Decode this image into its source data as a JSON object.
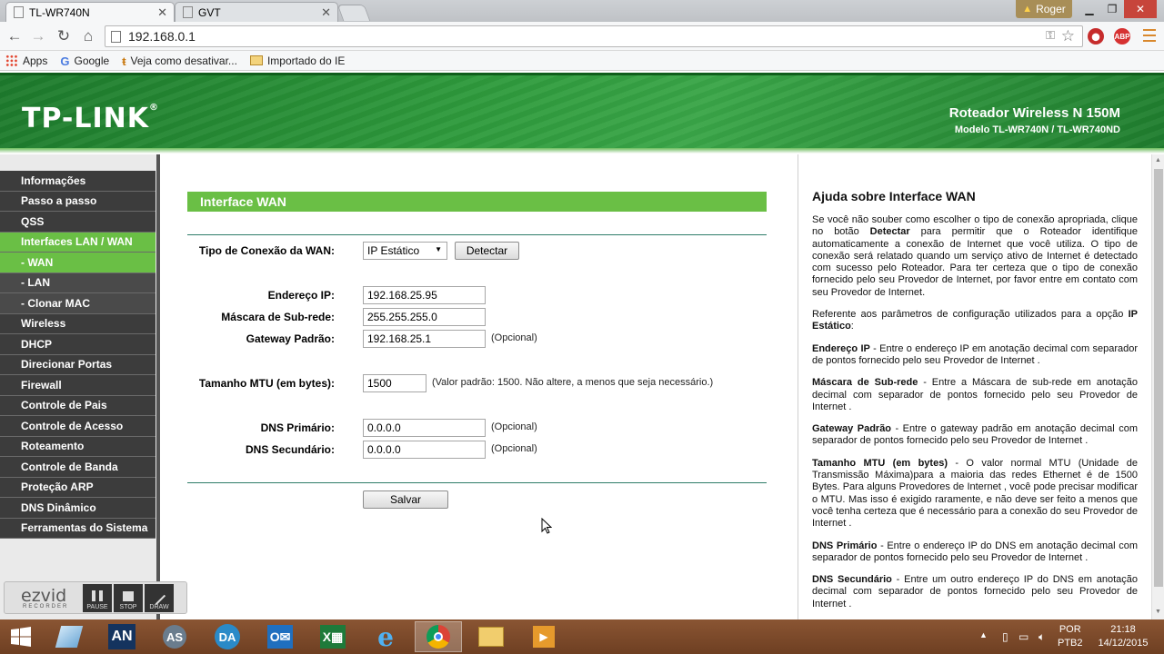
{
  "browser": {
    "tabs": [
      {
        "title": "TL-WR740N",
        "active": true
      },
      {
        "title": "GVT",
        "active": false
      }
    ],
    "user": "Roger",
    "url": "192.168.0.1",
    "bookmarks": [
      "Apps",
      "Google",
      "Veja como desativar...",
      "Importado do IE"
    ],
    "extensions": [
      "adblock-icon",
      "abp-icon"
    ]
  },
  "router": {
    "logo": "TP-LINK",
    "product_title": "Roteador Wireless N 150M",
    "product_model": "Modelo TL-WR740N / TL-WR740ND"
  },
  "menu": [
    {
      "label": "Informações",
      "active": false,
      "sub": false
    },
    {
      "label": "Passo a passo",
      "active": false,
      "sub": false
    },
    {
      "label": "QSS",
      "active": false,
      "sub": false
    },
    {
      "label": "Interfaces LAN / WAN",
      "active": true,
      "sub": false
    },
    {
      "label": "- WAN",
      "active": true,
      "sub": true
    },
    {
      "label": "- LAN",
      "active": false,
      "sub": true
    },
    {
      "label": "- Clonar MAC",
      "active": false,
      "sub": true
    },
    {
      "label": "Wireless",
      "active": false,
      "sub": false
    },
    {
      "label": "DHCP",
      "active": false,
      "sub": false
    },
    {
      "label": "Direcionar Portas",
      "active": false,
      "sub": false
    },
    {
      "label": "Firewall",
      "active": false,
      "sub": false
    },
    {
      "label": "Controle de Pais",
      "active": false,
      "sub": false
    },
    {
      "label": "Controle de Acesso",
      "active": false,
      "sub": false
    },
    {
      "label": "Roteamento",
      "active": false,
      "sub": false
    },
    {
      "label": "Controle de Banda",
      "active": false,
      "sub": false
    },
    {
      "label": "Proteção ARP",
      "active": false,
      "sub": false
    },
    {
      "label": "DNS Dinâmico",
      "active": false,
      "sub": false
    },
    {
      "label": "Ferramentas do Sistema",
      "active": false,
      "sub": false
    }
  ],
  "wan": {
    "section_title": "Interface WAN",
    "conn_type_label": "Tipo de Conexão da WAN:",
    "conn_type_value": "IP Estático",
    "detect_button": "Detectar",
    "ip_label": "Endereço IP:",
    "ip_value": "192.168.25.95",
    "mask_label": "Máscara de Sub-rede:",
    "mask_value": "255.255.255.0",
    "gateway_label": "Gateway Padrão:",
    "gateway_value": "192.168.25.1",
    "optional": "(Opcional)",
    "mtu_label": "Tamanho MTU (em bytes):",
    "mtu_value": "1500",
    "mtu_hint": "(Valor padrão: 1500. Não altere, a menos que seja necessário.)",
    "dns1_label": "DNS Primário:",
    "dns1_value": "0.0.0.0",
    "dns2_label": "DNS Secundário:",
    "dns2_value": "0.0.0.0",
    "save_button": "Salvar"
  },
  "help": {
    "title": "Ajuda sobre Interface WAN",
    "p1_a": "Se você não souber como escolher o tipo de conexão apropriada, clique no botão ",
    "p1_b": "Detectar",
    "p1_c": " para permitir que o Roteador identifique automaticamente a conexão de Internet que você utiliza. O tipo de conexão será relatado quando um serviço ativo de Internet é detectado com sucesso pelo Roteador. Para ter certeza que o tipo de conexão fornecido pelo seu Provedor de Internet, por favor entre em contato com seu Provedor de Internet.",
    "p2_a": "Referente aos parâmetros de configuração utilizados para a opção ",
    "p2_b": "IP Estático",
    "p2_c": ":",
    "ip_term": "Endereço IP",
    "ip_desc": " - Entre o endereço IP em anotação decimal com separador de pontos fornecido pelo seu Provedor de Internet .",
    "mask_term": "Máscara de Sub-rede",
    "mask_desc": " - Entre a Máscara de sub-rede em anotação decimal com separador de pontos fornecido pelo seu Provedor de Internet .",
    "gw_term": "Gateway Padrão",
    "gw_desc": " - Entre o gateway padrão em anotação decimal com separador de pontos fornecido pelo seu Provedor de Internet .",
    "mtu_term": "Tamanho MTU (em bytes)",
    "mtu_desc": " - O valor normal MTU (Unidade de Transmissão Máxima)para a maioria das redes Ethernet é de 1500 Bytes. Para alguns Provedores de Internet , você pode precisar modificar o MTU. Mas isso é exigido raramente, e não deve ser feito a menos que você tenha certeza que é necessário para a conexão do seu Provedor de Internet .",
    "dns1_term": "DNS Primário",
    "dns1_desc": " - Entre o endereço IP do DNS em anotação decimal com separador de pontos fornecido pelo seu Provedor de Internet .",
    "dns2_term": "DNS Secundário",
    "dns2_desc": " - Entre um outro endereço IP do DNS em anotação decimal com separador de pontos fornecido pelo seu Provedor de Internet ."
  },
  "ezvid": {
    "logo": "ezvid",
    "sub": "RECORDER",
    "buttons": [
      "PAUSE",
      "STOP",
      "DRAW"
    ]
  },
  "taskbar": {
    "apps": [
      "file-explorer-icon",
      "an-app-icon",
      "as-app-icon",
      "da-app-icon",
      "outlook-icon",
      "excel-icon",
      "ie-icon",
      "chrome-icon",
      "folder-icon",
      "media-icon"
    ],
    "lang": "POR",
    "lang2": "PTB2",
    "time": "21:18",
    "date": "14/12/2015"
  }
}
